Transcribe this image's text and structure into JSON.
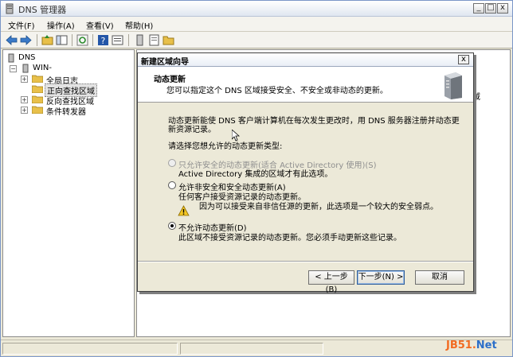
{
  "window": {
    "title": "DNS 管理器",
    "controls": {
      "minimize": "_",
      "maximize": "□",
      "close": "x"
    }
  },
  "menu": [
    "文件(F)",
    "操作(A)",
    "查看(V)",
    "帮助(H)"
  ],
  "toolbar_icons": [
    "back-arrow-icon",
    "forward-arrow-icon",
    "up-folder-icon",
    "show-tree-icon",
    "refresh-icon",
    "help-icon",
    "properties-icon",
    "server-list-icon",
    "record-icon",
    "folder-icon"
  ],
  "tree": {
    "root": "DNS",
    "server": "WIN-",
    "items": [
      "全局日志",
      "正向查找区域",
      "反向查找区域",
      "条件转发器"
    ]
  },
  "right_pane_peek": "域",
  "dialog": {
    "title": "新建区域向导",
    "close": "x",
    "header_title": "动态更新",
    "header_subtitle": "您可以指定这个 DNS 区域接受安全、不安全或非动态的更新。",
    "intro_line1": "动态更新能使 DNS 客户端计算机在每次发生更改时，用 DNS 服务器注册并动态更",
    "intro_line2": "新资源记录。",
    "prompt": "请选择您想允许的动态更新类型:",
    "options": [
      {
        "label": "只允许安全的动态更新(适合 Active Directory 使用)(S)",
        "desc": "Active Directory 集成的区域才有此选项。",
        "checked": false,
        "disabled": true
      },
      {
        "label": "允许非安全和安全动态更新(A)",
        "desc": "任何客户接受资源记录的动态更新。",
        "warning": "因为可以接受来自非信任源的更新，此选项是一个较大的安全弱点。",
        "checked": false,
        "disabled": false
      },
      {
        "label": "不允许动态更新(D)",
        "desc": "此区域不接受资源记录的动态更新。您必须手动更新这些记录。",
        "checked": true,
        "disabled": false
      }
    ],
    "buttons": {
      "back": "< 上一步(B)",
      "next": "下一步(N) >",
      "cancel": "取消"
    }
  },
  "watermark": {
    "part1": "JB51.",
    "part2": "Net"
  },
  "colors": {
    "accent": "#2f5d9a",
    "watermark_orange": "#f26b21",
    "watermark_blue": "#2b6fc9"
  }
}
